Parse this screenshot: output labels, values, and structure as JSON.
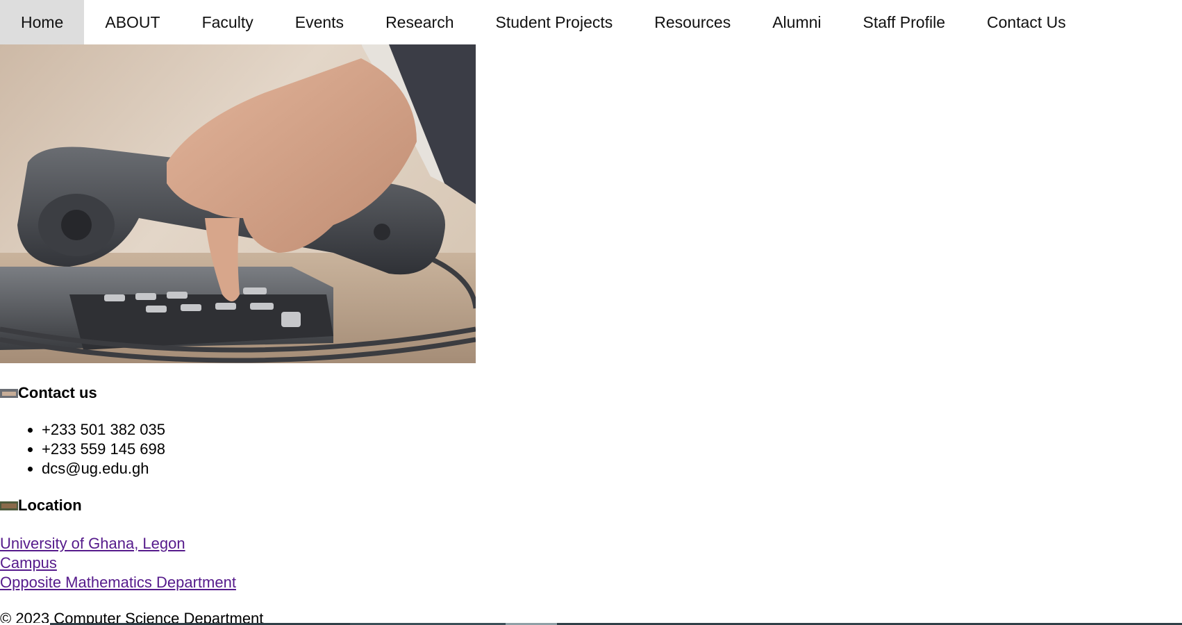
{
  "nav": {
    "items": [
      {
        "label": "Home",
        "active": true
      },
      {
        "label": "ABOUT"
      },
      {
        "label": "Faculty"
      },
      {
        "label": "Events"
      },
      {
        "label": "Research"
      },
      {
        "label": "Student Projects"
      },
      {
        "label": "Resources"
      },
      {
        "label": "Alumni"
      },
      {
        "label": "Staff Profile"
      },
      {
        "label": "Contact Us"
      }
    ]
  },
  "hero": {
    "image": "telephone-photo"
  },
  "contact": {
    "heading": "Contact us",
    "items": [
      "+233 501 382 035",
      "+233 559 145 698",
      "dcs@ug.edu.gh"
    ]
  },
  "location": {
    "heading": "Location",
    "links": [
      "University of Ghana, Legon",
      "Campus",
      "Opposite Mathematics Department"
    ]
  },
  "footer": {
    "text": "© 2023 Computer Science Department"
  },
  "colors": {
    "nav_active_bg": "#dddddd",
    "visited_link": "#551a8b"
  }
}
